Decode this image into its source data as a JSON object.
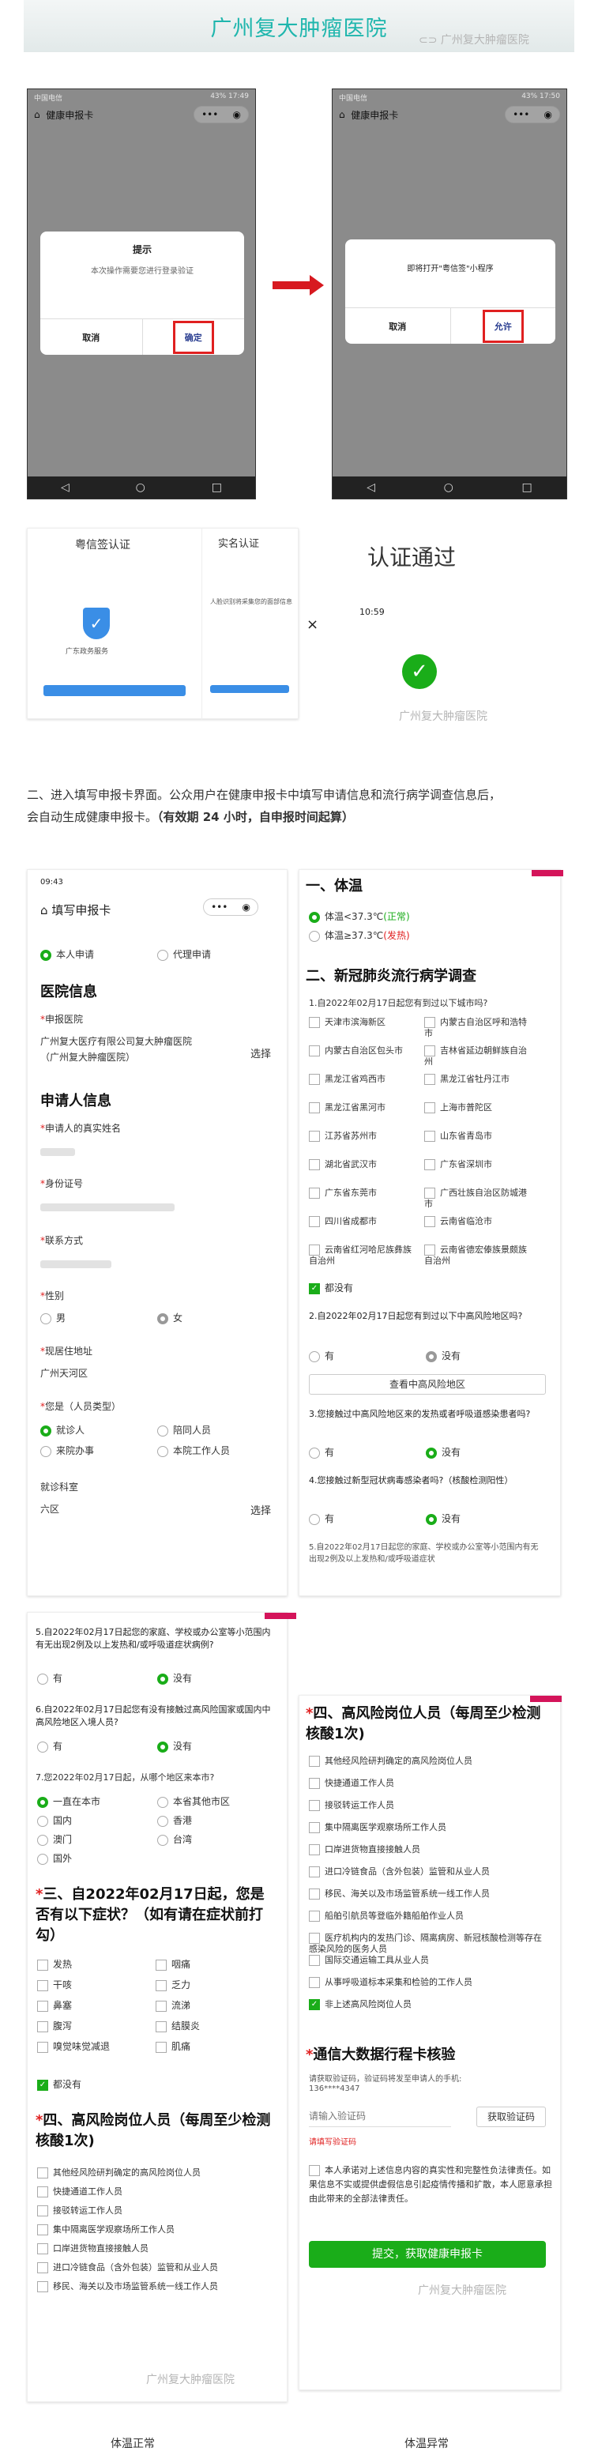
{
  "header": {
    "title": "广州复大肿瘤医院",
    "watermark": "广州复大肿瘤医院"
  },
  "phone1": {
    "status_left": "中国电信",
    "status_right": "43% 17:49",
    "nav_title": "健康申报卡",
    "capsule": "•••  ◉",
    "dialog_title": "提示",
    "dialog_msg": "本次操作需要您进行登录验证",
    "cancel": "取消",
    "confirm": "确定"
  },
  "phone2": {
    "status_left": "中国电信",
    "status_right": "43% 17:50",
    "nav_title": "健康申报卡",
    "capsule": "•••  ◉",
    "dialog_msg": "即将打开\"粤信签\"小程序",
    "cancel": "取消",
    "confirm": "允许"
  },
  "auth": {
    "left_title": "粤信签认证",
    "left_org": "广东政务服务",
    "right_title": "实名认证",
    "right_text": "人脸识别将采集您的面部信息",
    "x_mark": "×",
    "result_title": "认证通过",
    "time": "10:59",
    "result_watermark": "广州复大肿瘤医院"
  },
  "caption": {
    "line1": "二、进入填写申报卡界面。公众用户在健康申报卡中填写申请信息和流行病学调查信息后，",
    "line2a": "会自动生成健康申报卡。",
    "line2b": "（有效期 24 小时，自申报时间起算）"
  },
  "form1": {
    "status_time": "09:43",
    "nav_title": "填写申报卡",
    "opt_self": "本人申请",
    "opt_agent": "代理申请",
    "hospital_sec": "医院信息",
    "hospital_lbl": "申报医院",
    "hospital_val1": "广州复大医疗有限公司复大肿瘤医院",
    "hospital_val2": "（广州复大肿瘤医院）",
    "choose": "选择",
    "applicant_sec": "申请人信息",
    "name_lbl": "申请人的真实姓名",
    "id_lbl": "身份证号",
    "contact_lbl": "联系方式",
    "gender_lbl": "性别",
    "male": "男",
    "female": "女",
    "addr_lbl": "现居住地址",
    "addr_val": "广州天河区",
    "type_lbl": "您是（人员类型）",
    "types": [
      "就诊人",
      "陪同人员",
      "来院办事",
      "本院工作人员"
    ],
    "dept_lbl": "就诊科室",
    "dept_val": "六区",
    "choose2": "选择",
    "watermark": "广州复大肿瘤医院"
  },
  "form2": {
    "temp_sec": "一、体温",
    "temp_ok": "体温<37.3℃",
    "temp_ok_tag": "(正常)",
    "temp_bad": "体温≥37.3℃",
    "temp_bad_tag": "(发热)",
    "epi_sec": "二、新冠肺炎流行病学调查",
    "q1": "1.自2022年02月17日起您有到过以下城市吗?",
    "cities": [
      "天津市滨海新区",
      "内蒙古自治区呼和浩特市",
      "内蒙古自治区包头市",
      "吉林省延边朝鲜族自治州",
      "黑龙江省鸡西市",
      "黑龙江省牡丹江市",
      "黑龙江省黑河市",
      "上海市普陀区",
      "江苏省苏州市",
      "山东省青岛市",
      "湖北省武汉市",
      "广东省深圳市",
      "广东省东莞市",
      "广西壮族自治区防城港市",
      "四川省成都市",
      "云南省临沧市",
      "云南省红河哈尼族彝族自治州",
      "云南省德宏傣族景颇族自治州"
    ],
    "q1_none": "都没有",
    "q2": "2.自2022年02月17日起您有到过以下中高风险地区吗?",
    "yes": "有",
    "no": "没有",
    "view_risk": "查看中高风险地区",
    "q3": "3.您接触过中高风险地区来的发热或者呼吸道感染患者吗?",
    "q4": "4.您接触过新型冠状病毒感染者吗?（核酸检测阳性）",
    "q5_partial": "5.自2022年02月17日起您的家庭、学校或办公室等小范围内有无出现2例及以上发热和/或呼吸道症状"
  },
  "form3": {
    "q5": "5.自2022年02月17日起您的家庭、学校或办公室等小范围内有无出现2例及以上发热和/或呼吸道症状病例?",
    "yes": "有",
    "no": "没有",
    "q6": "6.自2022年02月17日起您有没有接触过高风险国家或国内中高风险地区入境人员?",
    "q7": "7.您2022年02月17日起，从哪个地区来本市?",
    "regions": [
      "一直在本市",
      "本省其他市区",
      "国内",
      "香港",
      "澳门",
      "台湾",
      "国外"
    ],
    "sym_sec": "三、自2022年02月17日起，您是否有以下症状？（如有请在症状前打勾）",
    "symptoms": [
      "发热",
      "咽痛",
      "干咳",
      "乏力",
      "鼻塞",
      "流涕",
      "腹泻",
      "结膜炎",
      "嗅觉味觉减退",
      "肌痛"
    ],
    "sym_none": "都没有",
    "high_sec": "四、高风险岗位人员（每周至少检测核酸1次)",
    "jobs": [
      "其他经风险研判确定的高风险岗位人员",
      "快捷通道工作人员",
      "接驳转运工作人员",
      "集中隔离医学观察场所工作人员",
      "口岸进货物直接接触人员",
      "进口冷链食品（含外包装）监管和从业人员",
      "移民、海关以及市场监管系统一线工作人员"
    ],
    "watermark": "广州复大肿瘤医院"
  },
  "form4": {
    "high_sec": "四、高风险岗位人员（每周至少检测核酸1次)",
    "jobs": [
      "其他经风险研判确定的高风险岗位人员",
      "快捷通道工作人员",
      "接驳转运工作人员",
      "集中隔离医学观察场所工作人员",
      "口岸进货物直接接触人员",
      "进口冷链食品（含外包装）监管和从业人员",
      "移民、海关以及市场监管系统一线工作人员",
      "船舶引航员等登临外籍船舶作业人员",
      "医疗机构内的发热门诊、隔离病房、新冠核酸检测等存在感染风险的医务人员",
      "国际交通运输工具从业人员",
      "从事呼吸道标本采集和检验的工作人员",
      "非上述高风险岗位人员"
    ],
    "trip_sec": "通信大数据行程卡核验",
    "trip_hint": "请获取验证码，验证码将发至申请人的手机:",
    "trip_phone": "136****4347",
    "code_ph": "请输入验证码",
    "get_code": "获取验证码",
    "code_hint": "请填写验证码",
    "agree_text": "本人承诺对上述信息内容的真实性和完整性负法律责任。如果信息不实或提供虚假信息引起疫情传播和扩散，本人愿意承担由此带来的全部法律责任。",
    "submit": "提交，获取健康申报卡",
    "watermark": "广州复大肿瘤医院"
  },
  "footer": {
    "normal": "体温正常",
    "abnormal": "体温异常"
  },
  "colors": {
    "brand": "#1fb6ad",
    "accent_green": "#1aad19",
    "highlight_red": "#e02020",
    "flag": "#d4145a"
  }
}
